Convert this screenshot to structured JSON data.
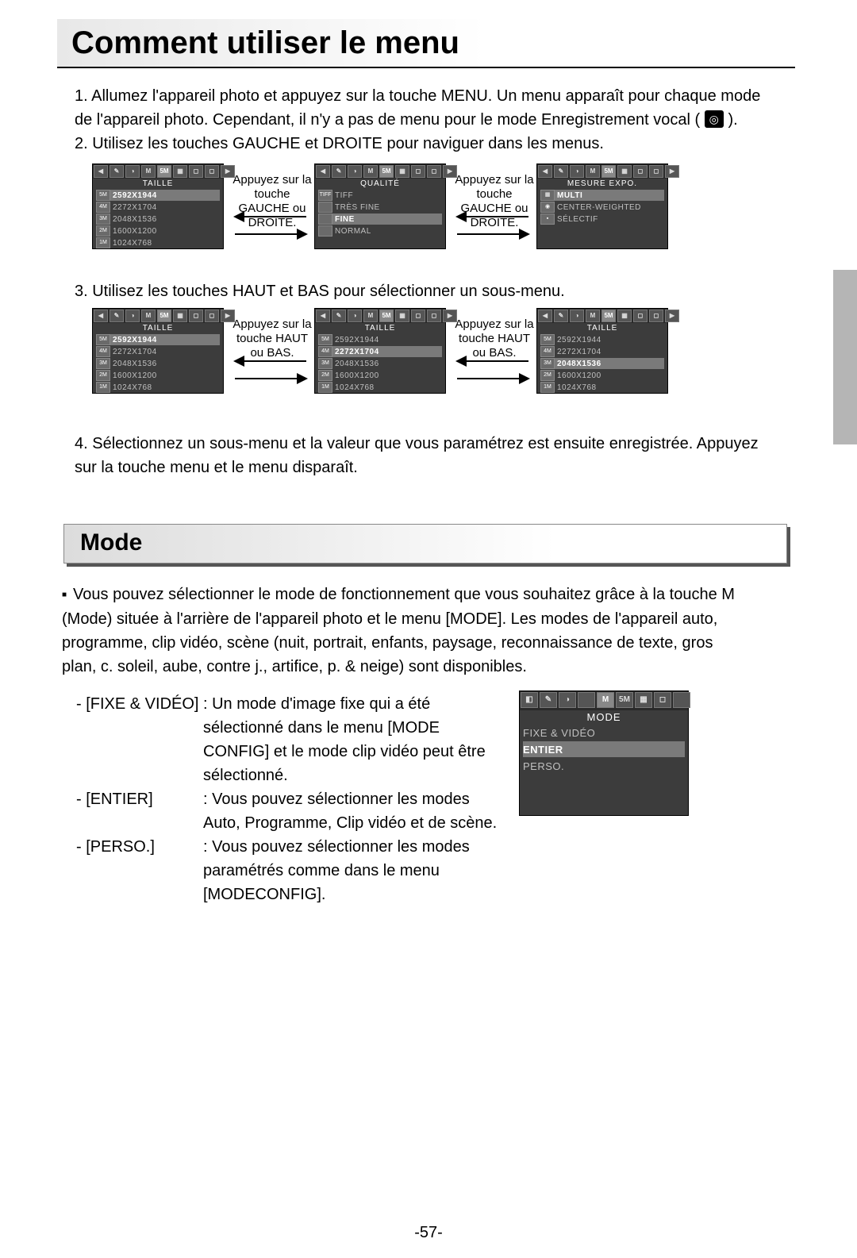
{
  "title": "Comment utiliser le menu",
  "steps": {
    "s1": "1. Allumez l'appareil photo et appuyez sur la touche MENU. Un menu apparaît pour chaque mode de l'appareil photo. Cependant, il n'y a pas de menu pour le mode Enregistrement vocal (",
    "s1_end": ").",
    "s2": "2. Utilisez les touches GAUCHE et DROITE pour naviguer dans les menus.",
    "s3": "3. Utilisez les touches HAUT et BAS pour sélectionner un sous-menu.",
    "s4": "4. Sélectionnez un sous-menu et la valeur que vous paramétrez est ensuite enregistrée. Appuyez sur la touche menu et le menu disparaît."
  },
  "voice_icon": "◎",
  "hint_lr": "Appuyez sur la touche GAUCHE ou DROITE.",
  "hint_ud": "Appuyez sur la touche HAUT ou BAS.",
  "osd_taille": {
    "title": "TAILLE",
    "items": [
      {
        "ic": "5M",
        "lbl": "2592X1944",
        "sel": true
      },
      {
        "ic": "4M",
        "lbl": "2272X1704"
      },
      {
        "ic": "3M",
        "lbl": "2048X1536"
      },
      {
        "ic": "2M",
        "lbl": "1600X1200"
      },
      {
        "ic": "1M",
        "lbl": "1024X768"
      }
    ]
  },
  "osd_qualite": {
    "title": "QUALITÉ",
    "items": [
      {
        "ic": "TIFF",
        "lbl": "TIFF"
      },
      {
        "ic": "",
        "lbl": "TRÈS FINE"
      },
      {
        "ic": "",
        "lbl": "FINE",
        "sel": true
      },
      {
        "ic": "",
        "lbl": "NORMAL"
      }
    ]
  },
  "osd_mesure": {
    "title": "MESURE EXPO.",
    "items": [
      {
        "ic": "▦",
        "lbl": "MULTI",
        "sel": true
      },
      {
        "ic": "◉",
        "lbl": "CENTER-WEIGHTED"
      },
      {
        "ic": "▪",
        "lbl": "SÉLECTIF"
      }
    ]
  },
  "osd_taille_b": {
    "title": "TAILLE",
    "items": [
      {
        "ic": "5M",
        "lbl": "2592X1944"
      },
      {
        "ic": "4M",
        "lbl": "2272X1704",
        "sel": true
      },
      {
        "ic": "3M",
        "lbl": "2048X1536"
      },
      {
        "ic": "2M",
        "lbl": "1600X1200"
      },
      {
        "ic": "1M",
        "lbl": "1024X768"
      }
    ]
  },
  "osd_taille_c": {
    "title": "TAILLE",
    "items": [
      {
        "ic": "5M",
        "lbl": "2592X1944"
      },
      {
        "ic": "4M",
        "lbl": "2272X1704"
      },
      {
        "ic": "3M",
        "lbl": "2048X1536",
        "sel": true
      },
      {
        "ic": "2M",
        "lbl": "1600X1200"
      },
      {
        "ic": "1M",
        "lbl": "1024X768"
      }
    ]
  },
  "mode": {
    "heading": "Mode",
    "intro": "Vous pouvez sélectionner le mode de fonctionnement que vous souhaitez grâce à la touche M (Mode) située à l'arrière de l'appareil photo et le menu [MODE]. Les modes de l'appareil auto, programme, clip vidéo, scène (nuit, portrait, enfants, paysage, reconnaissance de texte, gros plan, c. soleil, aube, contre j., artifice, p. & neige) sont disponibles.",
    "defs": [
      {
        "term": "- [FIXE & VIDÉO]",
        "desc": ": Un mode d'image fixe qui a été sélectionné dans le menu [MODE CONFIG] et le mode clip vidéo peut être sélectionné."
      },
      {
        "term": "- [ENTIER]",
        "desc": ": Vous pouvez sélectionner les modes Auto, Programme, Clip vidéo et de scène."
      },
      {
        "term": "- [PERSO.]",
        "desc": ": Vous pouvez sélectionner les modes paramétrés comme dans le menu [MODECONFIG]."
      }
    ]
  },
  "osd_mode": {
    "title": "MODE",
    "items": [
      {
        "lbl": "FIXE & VIDÉO"
      },
      {
        "lbl": "ENTIER",
        "sel": true
      },
      {
        "lbl": "PERSO."
      }
    ]
  },
  "page_number": "-57-"
}
